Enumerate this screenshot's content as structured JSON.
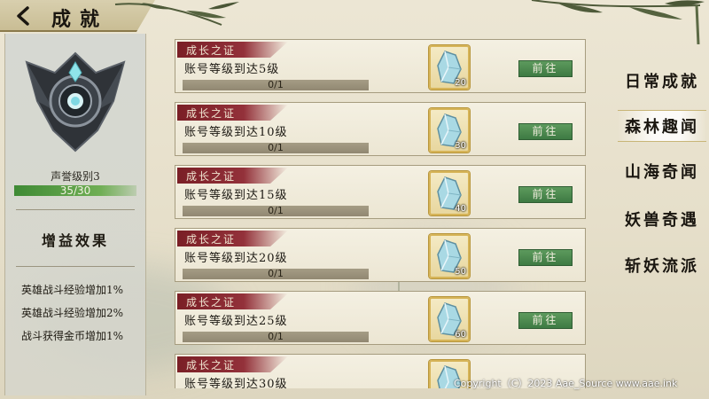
{
  "header": {
    "title": "成就",
    "back_icon": "chevron-left-icon"
  },
  "left_panel": {
    "rank_label": "声誉级别3",
    "progress_text": "35/30",
    "progress_fraction": 1.0,
    "bonus_title": "增益效果",
    "bonuses": [
      "英雄战斗经验增加1%",
      "英雄战斗经验增加2%",
      "战斗获得金币增加1%"
    ]
  },
  "quests": [
    {
      "tag": "成长之证",
      "desc": "账号等级到达5级",
      "progress": "0/1",
      "reward_count": "20",
      "button": "前往"
    },
    {
      "tag": "成长之证",
      "desc": "账号等级到达10级",
      "progress": "0/1",
      "reward_count": "30",
      "button": "前往"
    },
    {
      "tag": "成长之证",
      "desc": "账号等级到达15级",
      "progress": "0/1",
      "reward_count": "40",
      "button": "前往"
    },
    {
      "tag": "成长之证",
      "desc": "账号等级到达20级",
      "progress": "0/1",
      "reward_count": "50",
      "button": "前往"
    },
    {
      "tag": "成长之证",
      "desc": "账号等级到达25级",
      "progress": "0/1",
      "reward_count": "60",
      "button": "前往"
    },
    {
      "tag": "成长之证",
      "desc": "账号等级到达30级",
      "progress": "",
      "reward_count": "",
      "button": ""
    }
  ],
  "tabs": [
    {
      "label": "日常成就",
      "active": false
    },
    {
      "label": "森林趣闻",
      "active": true
    },
    {
      "label": "山海奇闻",
      "active": false
    },
    {
      "label": "妖兽奇遇",
      "active": false
    },
    {
      "label": "斩妖流派",
      "active": false
    }
  ],
  "watermark": "Copyright（C）2023 Aae_Source www.aae.ink",
  "colors": {
    "tag_red": "#7a1f26",
    "button_green": "#3e7a43",
    "reward_gold": "#d6b458"
  }
}
